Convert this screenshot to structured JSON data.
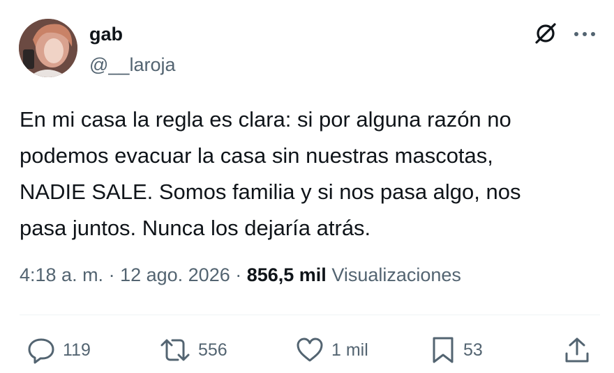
{
  "user": {
    "display_name": "gab",
    "handle": "@__laroja",
    "avatar_icon": "profile-photo"
  },
  "tweet": {
    "text": "En mi casa la regla es clara: si por alguna razón no\npodemos evacuar la casa sin nuestras mascotas,\nNADIE SALE. Somos familia y si nos pasa algo, nos\npasa juntos. Nunca los dejaría atrás."
  },
  "meta": {
    "time": "4:18 a. m.",
    "separator1": " · ",
    "date": "12 ago. 2026",
    "separator2": " · ",
    "views_count": "856,5 mil",
    "views_label": " Visualizaciones"
  },
  "actions": {
    "replies": "119",
    "retweets": "556",
    "likes": "1 mil",
    "bookmarks": "53"
  },
  "colors": {
    "text_primary": "#0f1419",
    "text_secondary": "#536471",
    "divider": "#eff3f4"
  },
  "icons": {
    "header": [
      "grok-icon",
      "more-icon"
    ],
    "actions": [
      "reply-icon",
      "retweet-icon",
      "like-icon",
      "bookmark-icon",
      "share-icon"
    ]
  }
}
